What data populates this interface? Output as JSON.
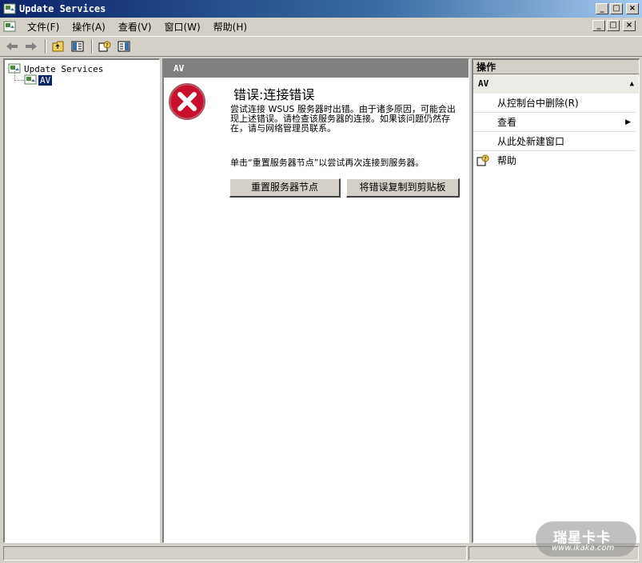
{
  "window": {
    "title": "Update Services",
    "buttons": {
      "minimize": "_",
      "maximize": "□",
      "close": "×"
    }
  },
  "menu": {
    "items": [
      "文件(F)",
      "操作(A)",
      "查看(V)",
      "窗口(W)",
      "帮助(H)"
    ]
  },
  "toolbar": {
    "buttons": [
      "back-icon",
      "forward-icon",
      "up-folder-icon",
      "show-hide-tree-icon",
      "help-icon",
      "action-pane-icon"
    ]
  },
  "tree": {
    "root": "Update Services",
    "child": "AV"
  },
  "main": {
    "header": "AV",
    "error_title": "错误:连接错误",
    "error_message": "尝试连接 WSUS 服务器时出错。由于诸多原因，可能会出现上述错误。请检查该服务器的连接。如果该问题仍然存在，请与网络管理员联系。",
    "hint": "单击“重置服务器节点”以尝试再次连接到服务器。",
    "reset_button": "重置服务器节点",
    "copy_button": "将错误复制到剪贴板"
  },
  "actions": {
    "header": "操作",
    "section": "AV",
    "items": [
      "从控制台中删除(R)",
      "查看",
      "从此处新建窗口",
      "帮助"
    ]
  },
  "watermark": {
    "title": "瑞星卡卡",
    "url": "www.ikaka.com"
  },
  "colors": {
    "title_gradient_start": "#0a246a",
    "title_gradient_end": "#a6caf0",
    "chrome": "#d4d0c8",
    "error_red": "#c8102e",
    "selection": "#0a246a"
  }
}
